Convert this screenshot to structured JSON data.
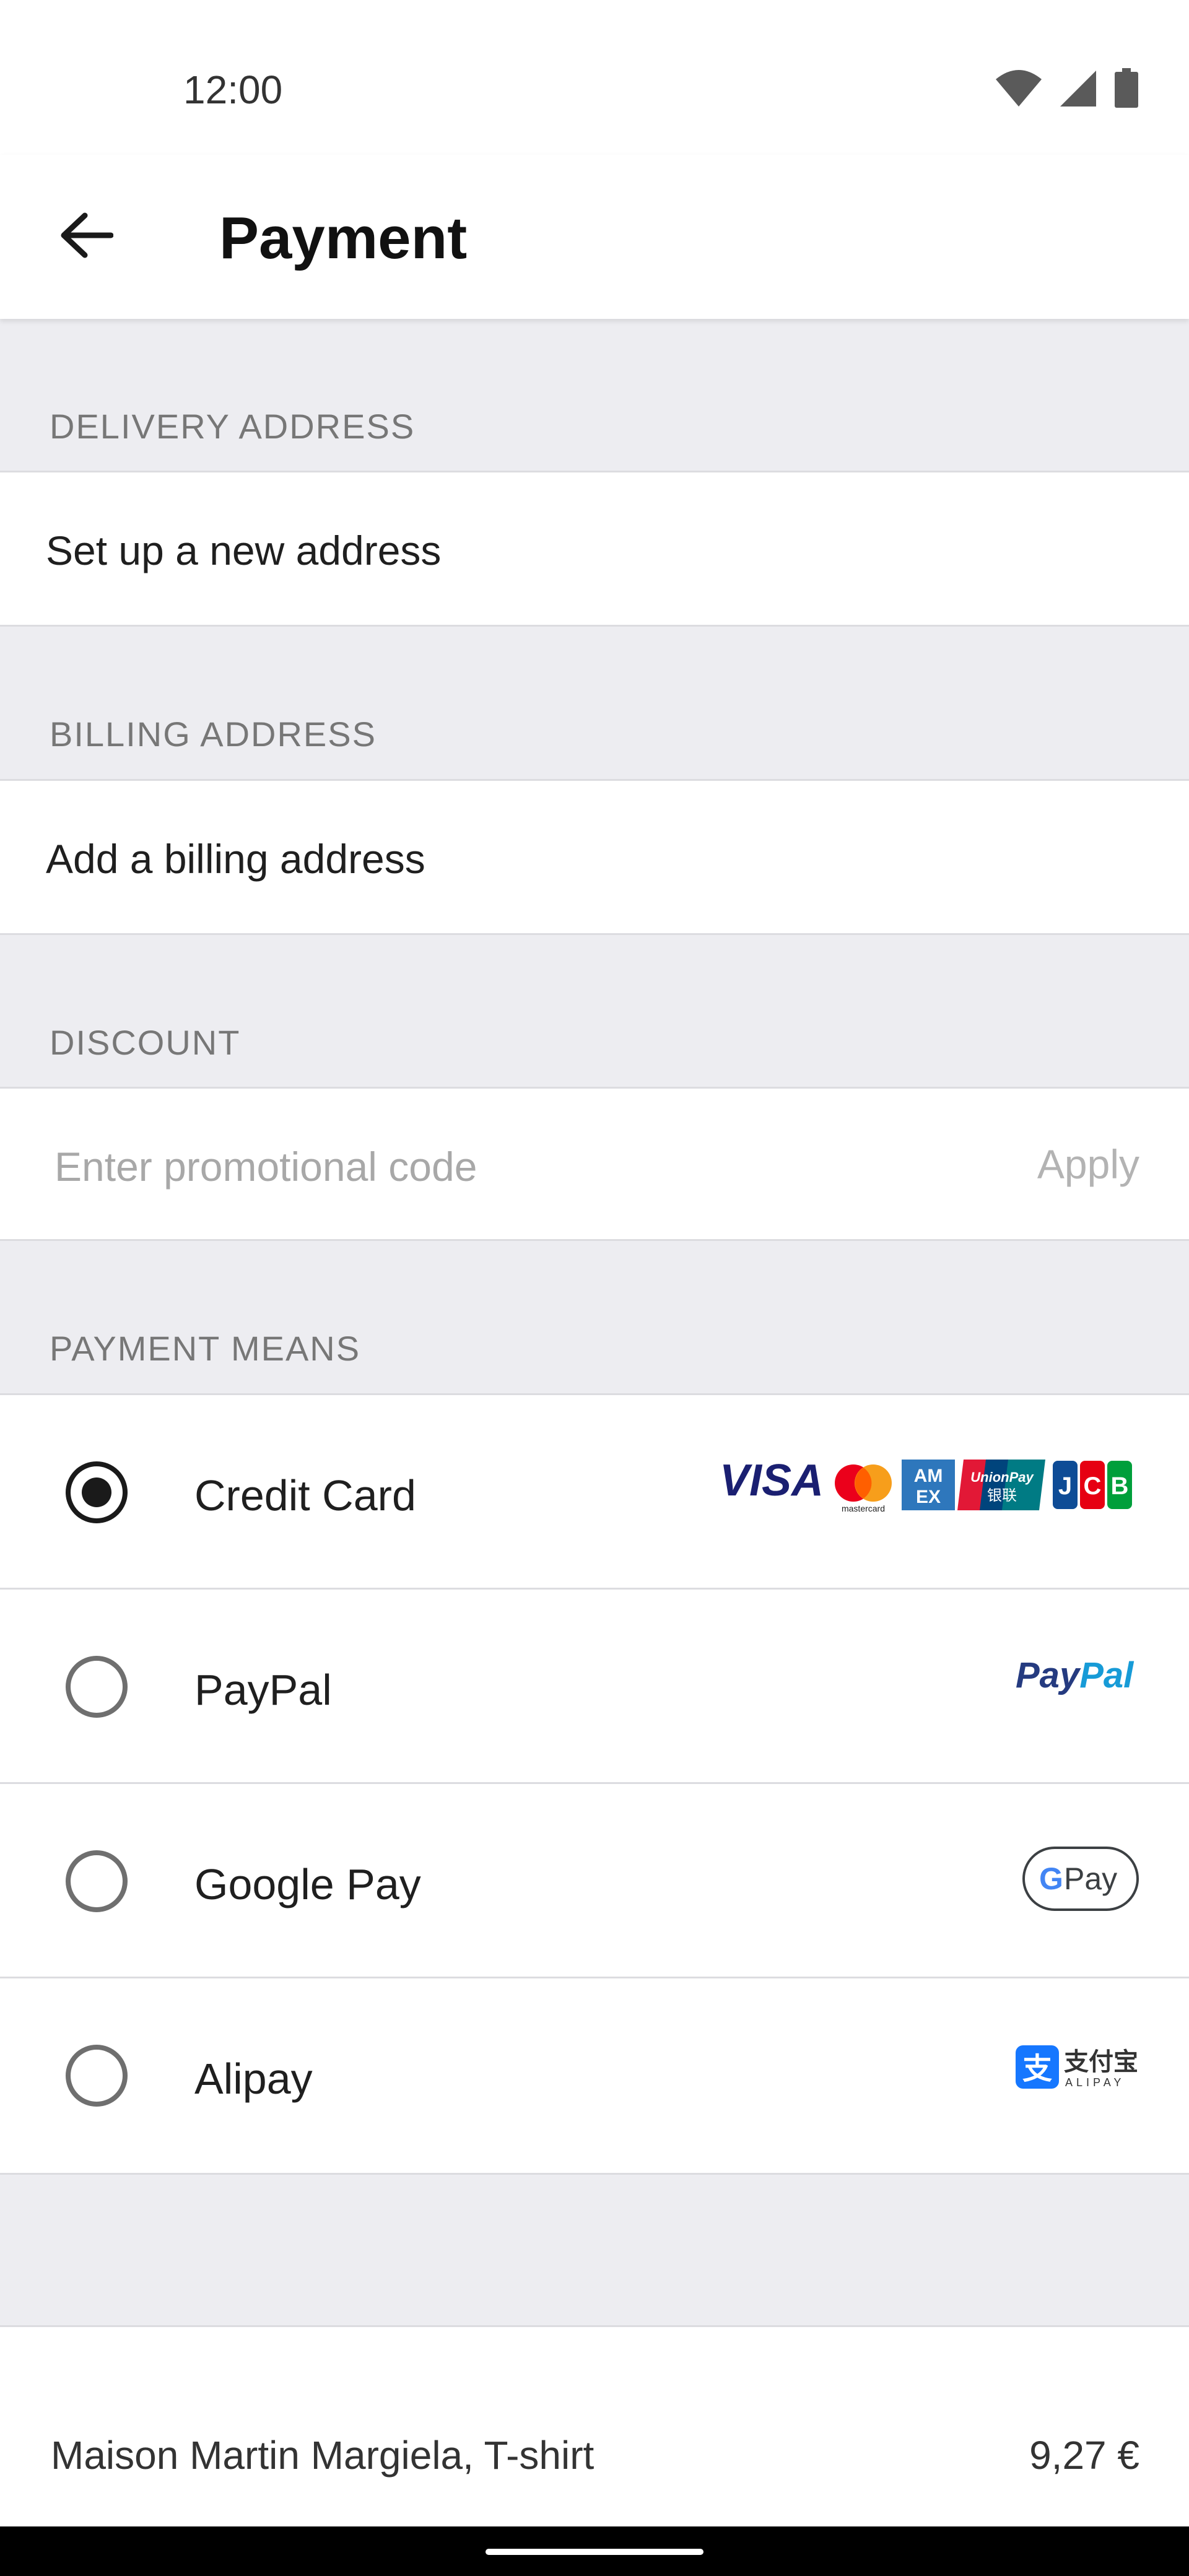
{
  "status_bar": {
    "time": "12:00",
    "icons": [
      "wifi-icon",
      "signal-icon",
      "battery-icon"
    ]
  },
  "header": {
    "title": "Payment",
    "back_icon": "arrow-left-icon"
  },
  "delivery": {
    "header": "DELIVERY ADDRESS",
    "action": "Set up a new address"
  },
  "billing": {
    "header": "BILLING ADDRESS",
    "action": "Add a billing address"
  },
  "discount": {
    "header": "DISCOUNT",
    "placeholder": "Enter promotional code",
    "value": "",
    "apply_label": "Apply"
  },
  "payment": {
    "header": "PAYMENT MEANS",
    "options": [
      {
        "label": "Credit Card",
        "selected": true,
        "logos": [
          "VISA",
          "mastercard",
          "AMEX",
          "UnionPay 银联",
          "JCB"
        ]
      },
      {
        "label": "PayPal",
        "selected": false,
        "logo_text": "PayPal"
      },
      {
        "label": "Google Pay",
        "selected": false,
        "logo_text": "G Pay"
      },
      {
        "label": "Alipay",
        "selected": false,
        "logo_text": "支付宝",
        "logo_sub": "ALIPAY"
      }
    ]
  },
  "order": {
    "product": "Maison Martin Margiela, T-shirt",
    "price": "9,27 €"
  },
  "colors": {
    "background": "#ededf1",
    "surface": "#ffffff",
    "paypal_dark": "#253b80",
    "paypal_light": "#179bd7",
    "alipay": "#1677ff"
  }
}
